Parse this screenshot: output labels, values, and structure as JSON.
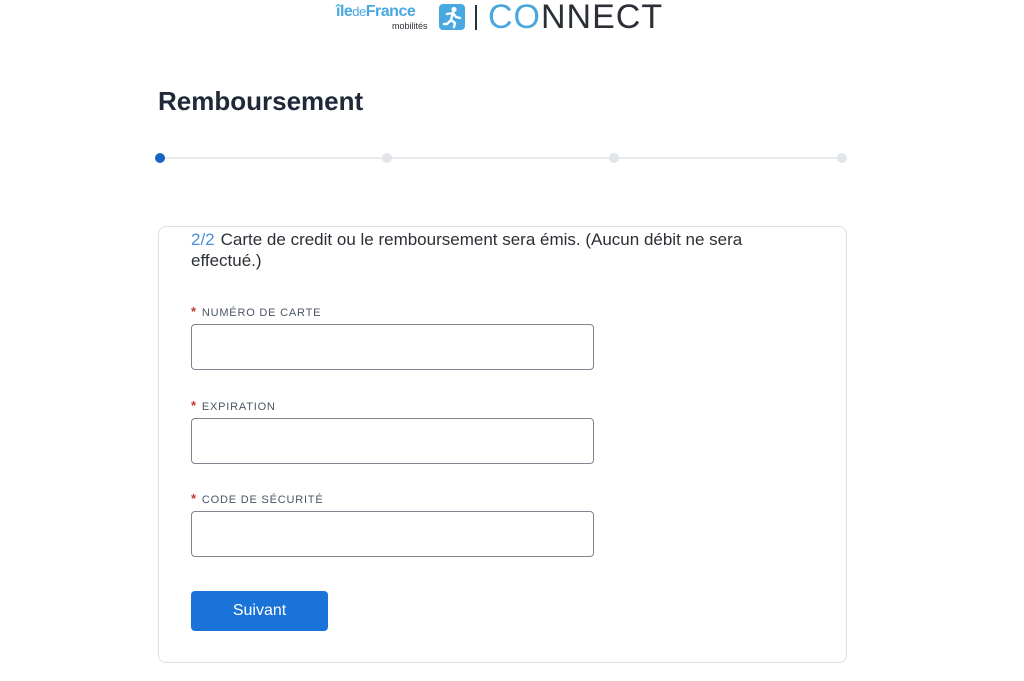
{
  "header": {
    "brand_main": "îleFrance",
    "brand_main_prefix": "île",
    "brand_de": "de",
    "brand_main_suffix": "France",
    "brand_sub": "mobilités",
    "connect_co": "CO",
    "connect_rest": "NNECT"
  },
  "page": {
    "title": "Remboursement"
  },
  "stepper": {
    "total_steps": 4,
    "active_step": 1
  },
  "form": {
    "step_indicator": "2/2",
    "intro_text": "Carte de credit ou le remboursement sera émis. (Aucun débit ne sera effectué.)",
    "required_mark": "*",
    "fields": [
      {
        "label": "NUMÉRO DE CARTE",
        "value": ""
      },
      {
        "label": "EXPIRATION",
        "value": ""
      },
      {
        "label": "CODE DE SÉCURITÉ",
        "value": ""
      }
    ],
    "submit_label": "Suivant"
  },
  "colors": {
    "brand_blue": "#4aa8e0",
    "primary_button": "#1a73d9",
    "active_step": "#1565c0",
    "required": "#c23934"
  }
}
